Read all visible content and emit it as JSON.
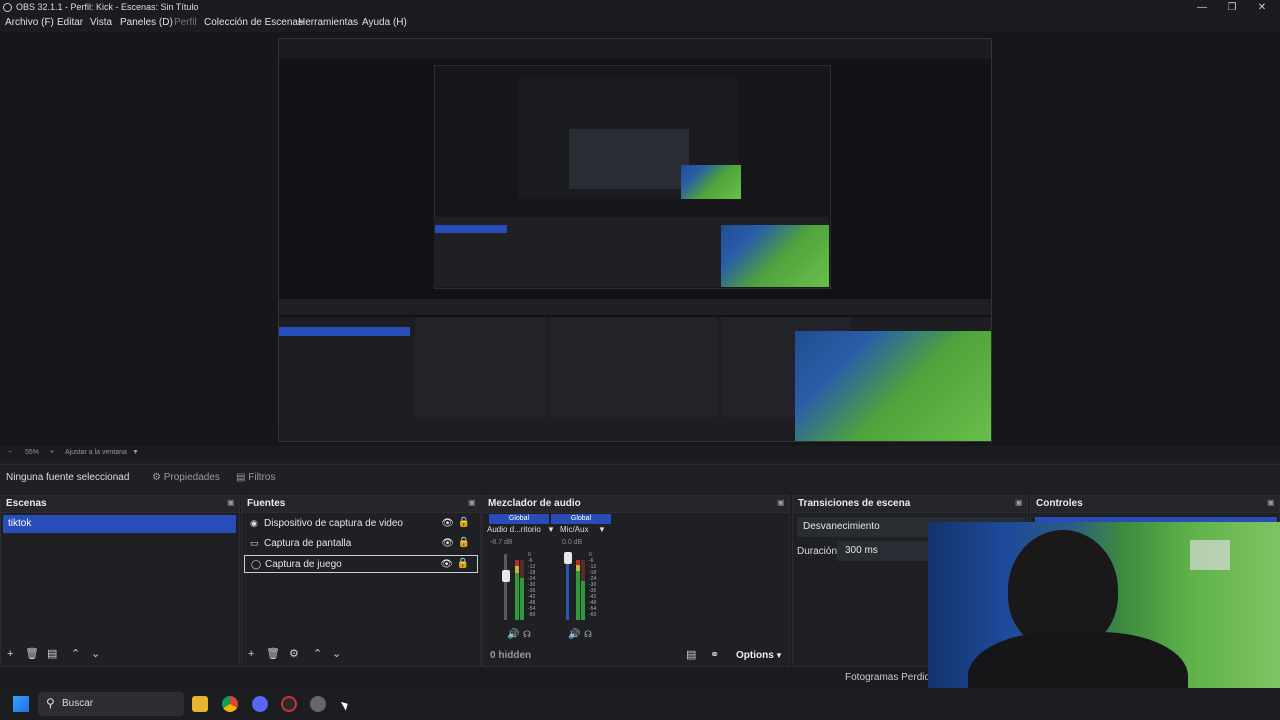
{
  "window": {
    "title": "OBS 32.1.1 - Perfil: Kick - Escenas: Sin Título"
  },
  "menu": {
    "items": [
      "Archivo (F)",
      "Editar",
      "Vista",
      "Paneles (D)",
      "Perfil",
      "Colección de Escenas",
      "Herramientas",
      "Ayuda (H)"
    ]
  },
  "preview": {
    "zoom": "55%",
    "fit_label": "Ajustar a la ventana"
  },
  "context": {
    "no_source": "Ninguna fuente seleccionad",
    "properties": "Propiedades",
    "filters": "Filtros"
  },
  "docks": {
    "scenes": {
      "title": "Escenas",
      "items": [
        "tiktok"
      ]
    },
    "sources": {
      "title": "Fuentes",
      "items": [
        {
          "label": "Dispositivo de captura de video",
          "icon": "camera-icon"
        },
        {
          "label": "Captura de pantalla",
          "icon": "monitor-icon"
        },
        {
          "label": "Captura de juego",
          "icon": "gamepad-icon"
        }
      ]
    },
    "mixer": {
      "title": "Mezclador de audio",
      "channels": [
        {
          "tag": "Global",
          "name": "Audio d...ritorio",
          "db": "-8.7 dB",
          "level": 0.72
        },
        {
          "tag": "Global",
          "name": "Mic/Aux",
          "db": "0.0 dB",
          "level": 0.9
        }
      ],
      "scale": [
        "0",
        "-6",
        "-12",
        "-18",
        "-24",
        "-30",
        "-36",
        "-42",
        "-48",
        "-54",
        "-60"
      ],
      "hidden": "0 hidden",
      "options": "Options"
    },
    "transitions": {
      "title": "Transiciones de escena",
      "selected": "Desvanecimiento",
      "duration_label": "Duración",
      "duration_value": "300 ms"
    },
    "controls": {
      "title": "Controles"
    }
  },
  "status": {
    "dropped_frames": "Fotogramas Perdidos"
  },
  "taskbar": {
    "search_placeholder": "Buscar"
  },
  "colors": {
    "accent": "#284cb8",
    "panel": "#1f2024",
    "background": "#1d1e22"
  }
}
